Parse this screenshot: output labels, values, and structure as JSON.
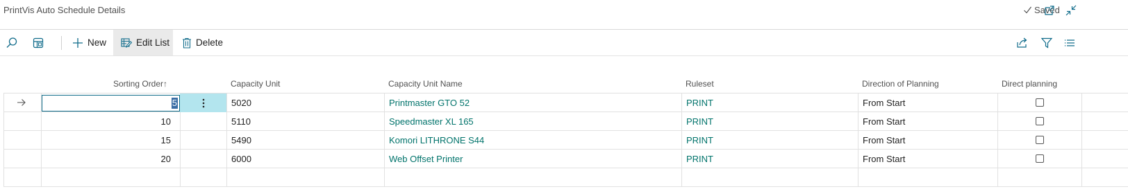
{
  "title": "PrintVis Auto Schedule Details",
  "status": {
    "saved": "Saved"
  },
  "actions": {
    "new": "New",
    "edit_list": "Edit List",
    "delete": "Delete"
  },
  "columns": {
    "sorting_order": "Sorting Order",
    "sort_arrow": "↑",
    "capacity_unit": "Capacity Unit",
    "capacity_unit_name": "Capacity Unit Name",
    "ruleset": "Ruleset",
    "direction": "Direction of Planning",
    "direct_planning": "Direct planning"
  },
  "rows": [
    {
      "sorting_order": "5",
      "capacity_unit": "5020",
      "capacity_unit_name": "Printmaster GTO 52",
      "ruleset": "PRINT",
      "direction": "From Start",
      "direct_planning": false
    },
    {
      "sorting_order": "10",
      "capacity_unit": "5110",
      "capacity_unit_name": "Speedmaster XL 165",
      "ruleset": "PRINT",
      "direction": "From Start",
      "direct_planning": false
    },
    {
      "sorting_order": "15",
      "capacity_unit": "5490",
      "capacity_unit_name": "Komori LITHRONE S44",
      "ruleset": "PRINT",
      "direction": "From Start",
      "direct_planning": false
    },
    {
      "sorting_order": "20",
      "capacity_unit": "6000",
      "capacity_unit_name": "Web Offset Printer",
      "ruleset": "PRINT",
      "direction": "From Start",
      "direct_planning": false
    }
  ],
  "accent_color": "#0f6b8a",
  "link_color": "#00736b"
}
